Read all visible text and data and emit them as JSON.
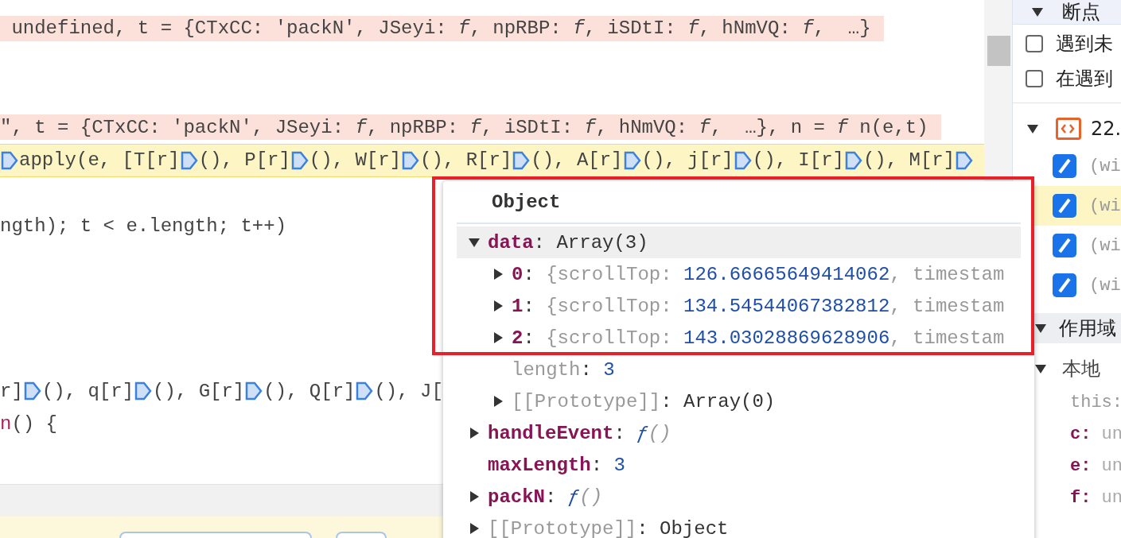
{
  "code_lines": [
    {
      "kind": "value-hint",
      "segments": [
        {
          "kind": "code",
          "text": " undefined, t = {CTxCC: 'packN', JSeyi: *f*, npRBP: *f*, iSDtI: *f*, hNmVQ: *f*,  …}"
        }
      ]
    },
    {
      "kind": "blank"
    },
    {
      "kind": "blank"
    },
    {
      "kind": "value-hint",
      "segments": [
        {
          "kind": "code",
          "text": "\", t = {CTxCC: 'packN', JSeyi: *f*, npRBP: *f*, iSDtI: *f*, hNmVQ: *f*,  …}, n = *f* n(e,t)"
        }
      ]
    },
    {
      "kind": "paused",
      "segments": [
        {
          "kind": "marker"
        },
        {
          "kind": "code",
          "text": "apply(e, [T[r]"
        },
        {
          "kind": "marker"
        },
        {
          "kind": "code",
          "text": "(), P[r]"
        },
        {
          "kind": "marker"
        },
        {
          "kind": "code",
          "text": "(), W[r]"
        },
        {
          "kind": "marker"
        },
        {
          "kind": "code",
          "text": "(), R[r]"
        },
        {
          "kind": "marker"
        },
        {
          "kind": "code",
          "text": "(), A[r]"
        },
        {
          "kind": "marker"
        },
        {
          "kind": "code",
          "text": "(), j[r]"
        },
        {
          "kind": "marker"
        },
        {
          "kind": "code",
          "text": "(), I[r]"
        },
        {
          "kind": "marker"
        },
        {
          "kind": "code",
          "text": "(), M[r]"
        },
        {
          "kind": "marker"
        }
      ]
    },
    {
      "kind": "blank"
    },
    {
      "kind": "plain",
      "segments": [
        {
          "kind": "code",
          "text": "ngth); t < e.length; t++)"
        }
      ]
    },
    {
      "kind": "blank"
    },
    {
      "kind": "blank"
    },
    {
      "kind": "blank"
    },
    {
      "kind": "blank"
    },
    {
      "kind": "plain",
      "segments": [
        {
          "kind": "code",
          "text": "r]"
        },
        {
          "kind": "marker"
        },
        {
          "kind": "code",
          "text": "(), q[r]"
        },
        {
          "kind": "marker"
        },
        {
          "kind": "code",
          "text": "(), G[r]"
        },
        {
          "kind": "marker"
        },
        {
          "kind": "code",
          "text": "(), Q[r]"
        },
        {
          "kind": "marker"
        },
        {
          "kind": "code",
          "text": "(), J["
        }
      ]
    },
    {
      "kind": "plain",
      "segments": [
        {
          "kind": "keyword",
          "text": "n"
        },
        {
          "kind": "code",
          "text": "() {"
        }
      ]
    }
  ],
  "popover": {
    "title": "Object",
    "properties": [
      {
        "key": "data",
        "sep": ":",
        "kind": "expandable",
        "expanded": true,
        "selected": true,
        "dim": false,
        "value": [
          {
            "kind": "plain",
            "text": "Array(3)"
          }
        ],
        "children": [
          {
            "key": "0",
            "sep": ":",
            "kind": "expandable",
            "expanded": false,
            "selected": false,
            "dim": false,
            "value": [
              {
                "kind": "preview",
                "text": "{scrollTop: "
              },
              {
                "kind": "number",
                "text": "126.66665649414062"
              },
              {
                "kind": "preview",
                "text": ", timestam"
              }
            ]
          },
          {
            "key": "1",
            "sep": ":",
            "kind": "expandable",
            "expanded": false,
            "selected": false,
            "dim": false,
            "value": [
              {
                "kind": "preview",
                "text": "{scrollTop: "
              },
              {
                "kind": "number",
                "text": "134.54544067382812"
              },
              {
                "kind": "preview",
                "text": ", timestam"
              }
            ]
          },
          {
            "key": "2",
            "sep": ":",
            "kind": "expandable",
            "expanded": false,
            "selected": false,
            "dim": false,
            "value": [
              {
                "kind": "preview",
                "text": "{scrollTop: "
              },
              {
                "kind": "number",
                "text": "143.03028869628906"
              },
              {
                "kind": "preview",
                "text": ", timestam"
              }
            ]
          },
          {
            "key": "length",
            "sep": ":",
            "kind": "leaf",
            "selected": false,
            "dim": true,
            "value": [
              {
                "kind": "number",
                "text": "3"
              }
            ]
          },
          {
            "key": "[[Prototype]]",
            "sep": ":",
            "kind": "expandable",
            "expanded": false,
            "selected": false,
            "dim": true,
            "value": [
              {
                "kind": "plain",
                "text": "Array(0)"
              }
            ]
          }
        ]
      },
      {
        "key": "handleEvent",
        "sep": ":",
        "kind": "expandable",
        "expanded": false,
        "selected": false,
        "dim": false,
        "value": [
          {
            "kind": "function",
            "text": "ƒ"
          },
          {
            "kind": "args",
            "text": "()"
          }
        ]
      },
      {
        "key": "maxLength",
        "sep": ":",
        "kind": "leaf",
        "selected": false,
        "dim": false,
        "value": [
          {
            "kind": "number",
            "text": "3"
          }
        ]
      },
      {
        "key": "packN",
        "sep": ":",
        "kind": "expandable",
        "expanded": false,
        "selected": false,
        "dim": false,
        "value": [
          {
            "kind": "function",
            "text": "ƒ"
          },
          {
            "kind": "args",
            "text": "()"
          }
        ]
      },
      {
        "key": "[[Prototype]]",
        "sep": ":",
        "kind": "expandable",
        "expanded": false,
        "selected": false,
        "dim": true,
        "value": [
          {
            "kind": "plain",
            "text": "Object"
          }
        ]
      }
    ]
  },
  "sidebar": {
    "breakpoints_header": {
      "label": "断点",
      "expanded": true
    },
    "options": [
      {
        "label": "遇到未",
        "checked": false
      },
      {
        "label": "在遇到",
        "checked": false
      }
    ],
    "file": {
      "name": "22.",
      "expanded": true
    },
    "breakpoints": [
      {
        "label": "(wi",
        "checked": true,
        "selected": false
      },
      {
        "label": "(wi",
        "checked": true,
        "selected": true
      },
      {
        "label": "(wi",
        "checked": true,
        "selected": false
      },
      {
        "label": "(wi",
        "checked": true,
        "selected": false
      }
    ],
    "scope_header": {
      "label": "作用域",
      "expanded": true
    },
    "scope": {
      "label": "本地",
      "expanded": true,
      "variables": [
        {
          "key": "this",
          "sep": ":",
          "dim": true
        },
        {
          "key": "c",
          "sep": ":",
          "value": "un",
          "dim": false
        },
        {
          "key": "e",
          "sep": ":",
          "value": "un",
          "dim": false
        },
        {
          "key": "f",
          "sep": ":",
          "value": "un",
          "dim": false
        }
      ]
    }
  }
}
